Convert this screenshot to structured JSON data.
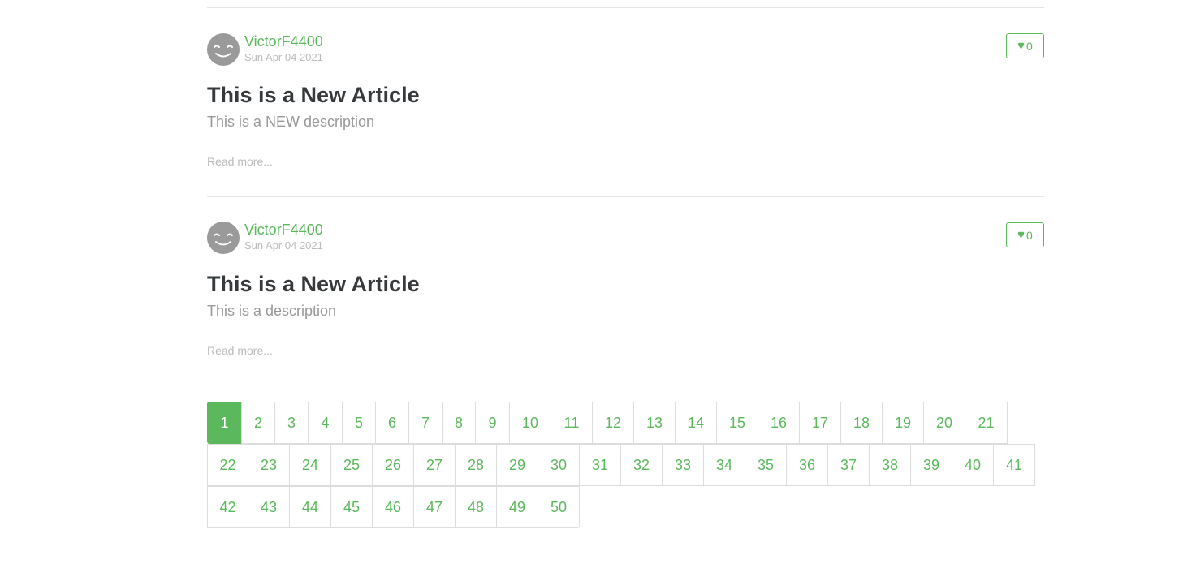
{
  "articles": [
    {
      "author": "VictorF4400",
      "date": "Sun Apr 04 2021",
      "likes": "0",
      "title": "This is a New Article",
      "description": "This is a NEW description",
      "read_more": "Read more..."
    },
    {
      "author": "VictorF4400",
      "date": "Sun Apr 04 2021",
      "likes": "0",
      "title": "This is a New Article",
      "description": "This is a description",
      "read_more": "Read more..."
    }
  ],
  "pagination": {
    "active_page": "1",
    "pages": [
      "1",
      "2",
      "3",
      "4",
      "5",
      "6",
      "7",
      "8",
      "9",
      "10",
      "11",
      "12",
      "13",
      "14",
      "15",
      "16",
      "17",
      "18",
      "19",
      "20",
      "21",
      "22",
      "23",
      "24",
      "25",
      "26",
      "27",
      "28",
      "29",
      "30",
      "31",
      "32",
      "33",
      "34",
      "35",
      "36",
      "37",
      "38",
      "39",
      "40",
      "41",
      "42",
      "43",
      "44",
      "45",
      "46",
      "47",
      "48",
      "49",
      "50"
    ]
  },
  "icons": {
    "like": "heart-icon",
    "avatar": "smiley-avatar-icon"
  },
  "colors": {
    "accent": "#5cb85c",
    "title": "#373a3c",
    "muted": "#bbbbbb"
  }
}
